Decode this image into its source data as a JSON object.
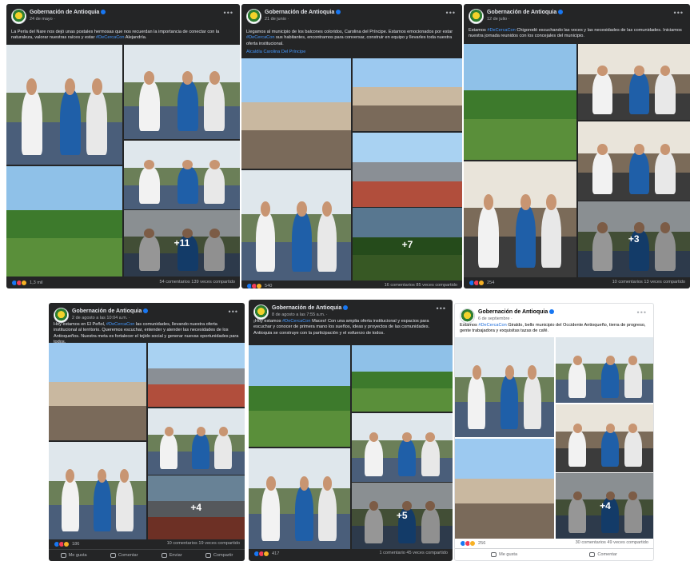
{
  "page": {
    "name": "Gobernación de Antioquia"
  },
  "colors": {
    "accent": "#1877f2",
    "link": "#4599ff",
    "dark_bg": "#242526",
    "love": "#f33e58"
  },
  "icons": {
    "like": "like-icon",
    "love": "love-icon",
    "care": "care-icon",
    "comment": "comment-icon",
    "share": "share-icon",
    "send": "send-icon",
    "more": "more-options-icon",
    "verified": "verified-icon"
  },
  "posts": [
    {
      "date": "24 de mayo · ",
      "text": "La Perla del Nare nos dejó unas postales hermosas que nos recuerdan la importancia de conectar con la naturaleza, valorar nuestras raíces y estar ",
      "hashtag": "#DeCercaCon",
      "text_end": " Alejandría.",
      "more_photos": "+11",
      "reactions": "1,3 mil",
      "comments": "54 comentarios",
      "shares": "139 veces compartido"
    },
    {
      "date": "21 de junio · ",
      "text": "Llegamos al municipio de los balcones coloridos, Carolina del Príncipe. Estamos emocionados por estar ",
      "hashtag": "#DeCercaCon",
      "text_end": " sus habitantes, encontrarnos para conversar, construir en equipo y llevarles toda nuestra oferta institucional.",
      "link": "Alcaldía Carolina Del Príncipe",
      "more_photos": "+7",
      "reactions": "540",
      "comments": "16 comentarios",
      "shares": "85 veces compartido"
    },
    {
      "date": "12 de julio · ",
      "text": "Estamos ",
      "hashtag": "#DeCercaCon",
      "text_end": " Chigorodó escuchando las voces y las necesidades de las comunidades. Iniciamos nuestra jornada reunidos con los concejales del municipio.",
      "more_photos": "+3",
      "reactions": "254",
      "comments": "10 comentarios",
      "shares": "13 veces compartido"
    },
    {
      "date": "2 de agosto a las 10:04 a.m. · ",
      "text": "Hoy estamos en El Peñol, ",
      "hashtag": "#DeCercaCon",
      "text_end": " las comunidades, llevando nuestra oferta institucional al territorio. Queremos escuchar, entender y atender las necesidades de los Antioqueños. Nuestra meta es fortalecer el tejido social y generar nuevas oportunidades para todos.",
      "more_photos": "+4",
      "reactions": "186",
      "comments": "10 comentarios",
      "shares": "19 veces compartido",
      "actions": [
        "Me gusta",
        "Comentar",
        "Enviar",
        "Compartir"
      ]
    },
    {
      "date": "8 de agosto a las 7:55 a.m. · ",
      "text": "¡Hoy estamos ",
      "hashtag": "#DeCercaCon",
      "text_end": " Maceo! Con una amplia oferta institucional y espacios para escuchar y conocer de primera mano los sueños, ideas y proyectos de las comunidades. Antioquia se construye con la participación y el esfuerzo de todos.",
      "more_photos": "+5",
      "reactions": "417",
      "comments": "1 comentario",
      "shares": "45 veces compartido"
    },
    {
      "date": "6 de septiembre · ",
      "text": "Estamos ",
      "hashtag": "#DeCercaCon",
      "text_end": " Giraldo, bello municipio del Occidente Antioqueño, tierra de progreso, gente trabajadora y exquisitas tazas de café.",
      "more_photos": "+4",
      "reactions": "256",
      "comments": "30 comentarios",
      "shares": "49 veces compartido",
      "actions": [
        "Me gusta",
        "Comentar"
      ]
    }
  ],
  "photo_palettes": {
    "nature": [
      "#8fc1e8",
      "#3d7a2c",
      "#5a8f3a"
    ],
    "town": [
      "#9cc9f0",
      "#c9b8a0",
      "#7a6a5a"
    ],
    "people": [
      "#dfe7ec",
      "#6b7f58",
      "#4a5e7a"
    ],
    "meeting": [
      "#e9e4da",
      "#7b6b59",
      "#3b3b3b"
    ],
    "street": [
      "#a9d2f2",
      "#8a8f95",
      "#b14e3c"
    ]
  }
}
